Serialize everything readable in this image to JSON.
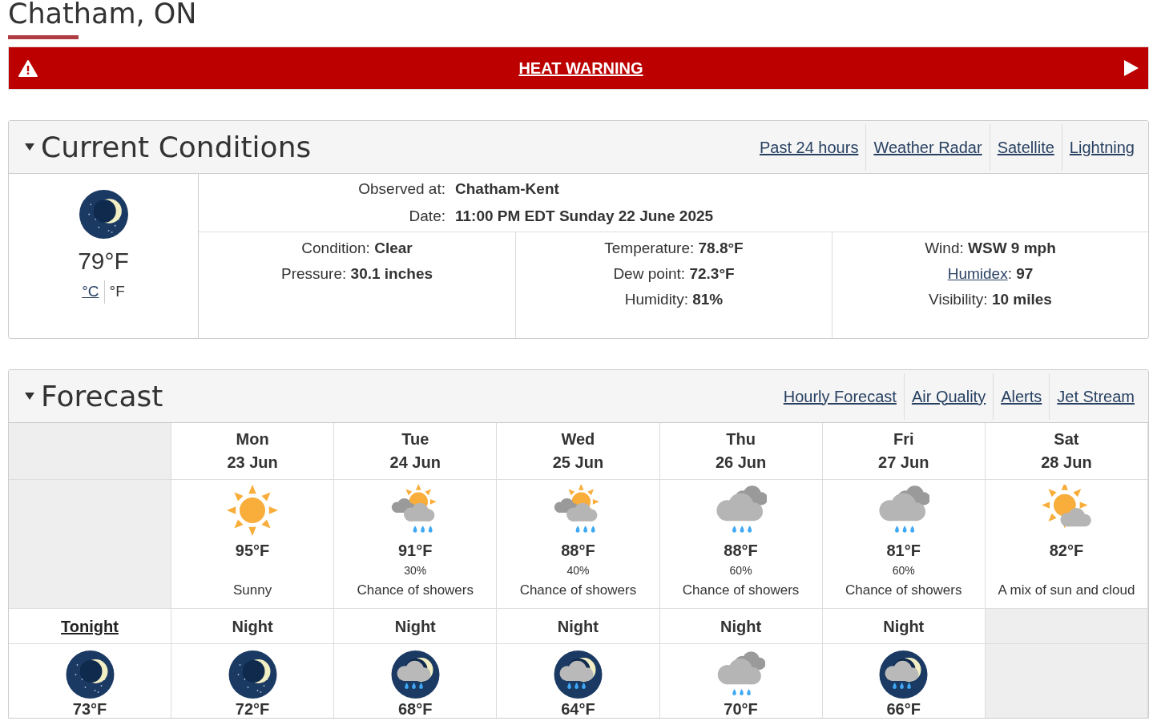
{
  "location": {
    "title": "Chatham, ON"
  },
  "alert": {
    "label": "HEAT WARNING"
  },
  "current_conditions": {
    "title": "Current Conditions",
    "expanded": true,
    "links": [
      "Past 24 hours",
      "Weather Radar",
      "Satellite",
      "Lightning"
    ],
    "kind": "clear-night",
    "temperature": "79°F",
    "units": [
      {
        "label": "°C",
        "selected": false
      },
      {
        "label": "°F",
        "selected": true
      }
    ],
    "observed_at": {
      "label": "Observed at:",
      "value": "Chatham-Kent"
    },
    "date": {
      "label": "Date:",
      "value": "11:00 PM EDT Sunday 22 June 2025"
    },
    "columns": [
      [
        {
          "label": "Condition:",
          "value": "Clear"
        },
        {
          "label": "Pressure:",
          "value": "30.1 inches"
        }
      ],
      [
        {
          "label": "Temperature:",
          "value": "78.8°F"
        },
        {
          "label": "Dew point:",
          "value": "72.3°F"
        },
        {
          "label": "Humidity:",
          "value": "81%"
        }
      ],
      [
        {
          "label": "Wind:",
          "value": "WSW 9 mph"
        },
        {
          "label": "Humidex",
          "link": true,
          "separator": ":",
          "value": "97"
        },
        {
          "label": "Visibility:",
          "value": "10 miles"
        }
      ]
    ]
  },
  "forecast": {
    "title": "Forecast",
    "expanded": true,
    "links": [
      "Hourly Forecast",
      "Air Quality",
      "Alerts",
      "Jet Stream"
    ],
    "days": [
      {
        "day": "Mon",
        "date": "23 Jun",
        "kind": "sunny",
        "temperature": "95°F",
        "summary": "Sunny"
      },
      {
        "day": "Tue",
        "date": "24 Jun",
        "kind": "sun-cloud-rain",
        "temperature": "91°F",
        "pop": "30%",
        "summary": "Chance of showers"
      },
      {
        "day": "Wed",
        "date": "25 Jun",
        "kind": "sun-cloud-rain",
        "temperature": "88°F",
        "pop": "40%",
        "summary": "Chance of showers"
      },
      {
        "day": "Thu",
        "date": "26 Jun",
        "kind": "cloud-rain",
        "temperature": "88°F",
        "pop": "60%",
        "summary": "Chance of showers"
      },
      {
        "day": "Fri",
        "date": "27 Jun",
        "kind": "cloud-rain",
        "temperature": "81°F",
        "pop": "60%",
        "summary": "Chance of showers"
      },
      {
        "day": "Sat",
        "date": "28 Jun",
        "kind": "sun-cloud",
        "temperature": "82°F",
        "summary": "A mix of sun and cloud"
      }
    ],
    "nights": [
      {
        "label": "Tonight",
        "link": true,
        "kind": "clear-night",
        "temperature": "73°F"
      },
      {
        "label": "Night",
        "link": false,
        "kind": "clear-night",
        "temperature": "72°F"
      },
      {
        "label": "Night",
        "link": false,
        "kind": "night-cloud-rain",
        "temperature": "68°F"
      },
      {
        "label": "Night",
        "link": false,
        "kind": "night-cloud-rain",
        "temperature": "64°F"
      },
      {
        "label": "Night",
        "link": false,
        "kind": "cloud-rain",
        "temperature": "70°F"
      },
      {
        "label": "Night",
        "link": false,
        "kind": "night-cloud-rain",
        "temperature": "66°F"
      }
    ]
  }
}
